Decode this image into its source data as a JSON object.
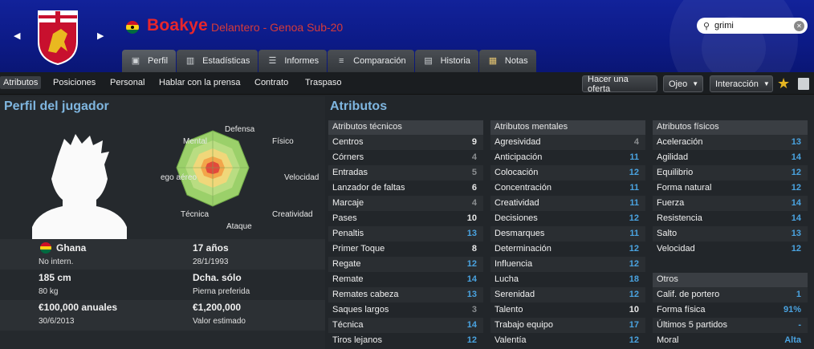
{
  "header": {
    "player_name": "Boakye",
    "player_role": "Delantero - Genoa Sub-20",
    "search_value": "grimi",
    "tabs": [
      {
        "label": "Perfil",
        "icon": "profile-icon",
        "active": true
      },
      {
        "label": "Estadísticas",
        "icon": "stats-icon",
        "active": false
      },
      {
        "label": "Informes",
        "icon": "reports-icon",
        "active": false
      },
      {
        "label": "Comparación",
        "icon": "compare-icon",
        "active": false
      },
      {
        "label": "Historia",
        "icon": "history-icon",
        "active": false
      },
      {
        "label": "Notas",
        "icon": "notes-icon",
        "active": false
      }
    ]
  },
  "subnav": {
    "items": [
      "Atributos",
      "Posiciones",
      "Personal",
      "Hablar con la prensa",
      "Contrato",
      "Traspaso"
    ],
    "make_offer": "Hacer una oferta",
    "eye": "Ojeo",
    "interaction": "Interacción"
  },
  "profile": {
    "title": "Perfil del jugador",
    "radar_labels": {
      "top": "Defensa",
      "top_right": "Físico",
      "right": "Velocidad",
      "bottom_right": "Creatividad",
      "bottom": "Ataque",
      "bottom_left": "Técnica",
      "left": "ego aéreo",
      "top_left": "Mental"
    },
    "nationality": "Ghana",
    "intl": "No intern.",
    "age": "17 años",
    "dob": "28/1/1993",
    "height": "185 cm",
    "weight": "80 kg",
    "foot": "Dcha. sólo",
    "foot_label": "Pierna preferida",
    "wage": "€100,000 anuales",
    "contract_end": "30/6/2013",
    "value": "€1,200,000",
    "value_label": "Valor estimado"
  },
  "attributes": {
    "title": "Atributos",
    "technical": {
      "head": "Atributos técnicos",
      "rows": [
        {
          "name": "Centros",
          "value": "9",
          "tone": "mid"
        },
        {
          "name": "Córners",
          "value": "4",
          "tone": "lo"
        },
        {
          "name": "Entradas",
          "value": "5",
          "tone": "lo"
        },
        {
          "name": "Lanzador de faltas",
          "value": "6",
          "tone": "mid"
        },
        {
          "name": "Marcaje",
          "value": "4",
          "tone": "lo"
        },
        {
          "name": "Pases",
          "value": "10",
          "tone": "mid"
        },
        {
          "name": "Penaltis",
          "value": "13",
          "tone": "hi"
        },
        {
          "name": "Primer Toque",
          "value": "8",
          "tone": "mid"
        },
        {
          "name": "Regate",
          "value": "12",
          "tone": "hi"
        },
        {
          "name": "Remate",
          "value": "14",
          "tone": "hi"
        },
        {
          "name": "Remates cabeza",
          "value": "13",
          "tone": "hi"
        },
        {
          "name": "Saques largos",
          "value": "3",
          "tone": "lo"
        },
        {
          "name": "Técnica",
          "value": "14",
          "tone": "hi"
        },
        {
          "name": "Tiros lejanos",
          "value": "12",
          "tone": "hi"
        }
      ]
    },
    "mental": {
      "head": "Atributos mentales",
      "rows": [
        {
          "name": "Agresividad",
          "value": "4",
          "tone": "lo"
        },
        {
          "name": "Anticipación",
          "value": "11",
          "tone": "hi"
        },
        {
          "name": "Colocación",
          "value": "12",
          "tone": "hi"
        },
        {
          "name": "Concentración",
          "value": "11",
          "tone": "hi"
        },
        {
          "name": "Creatividad",
          "value": "11",
          "tone": "hi"
        },
        {
          "name": "Decisiones",
          "value": "12",
          "tone": "hi"
        },
        {
          "name": "Desmarques",
          "value": "11",
          "tone": "hi"
        },
        {
          "name": "Determinación",
          "value": "12",
          "tone": "hi"
        },
        {
          "name": "Influencia",
          "value": "12",
          "tone": "hi"
        },
        {
          "name": "Lucha",
          "value": "18",
          "tone": "hi"
        },
        {
          "name": "Serenidad",
          "value": "12",
          "tone": "hi"
        },
        {
          "name": "Talento",
          "value": "10",
          "tone": "mid"
        },
        {
          "name": "Trabajo equipo",
          "value": "17",
          "tone": "hi"
        },
        {
          "name": "Valentía",
          "value": "12",
          "tone": "hi"
        }
      ]
    },
    "physical": {
      "head": "Atributos físicos",
      "rows": [
        {
          "name": "Aceleración",
          "value": "13",
          "tone": "hi"
        },
        {
          "name": "Agilidad",
          "value": "14",
          "tone": "hi"
        },
        {
          "name": "Equilibrio",
          "value": "12",
          "tone": "hi"
        },
        {
          "name": "Forma natural",
          "value": "12",
          "tone": "hi"
        },
        {
          "name": "Fuerza",
          "value": "14",
          "tone": "hi"
        },
        {
          "name": "Resistencia",
          "value": "14",
          "tone": "hi"
        },
        {
          "name": "Salto",
          "value": "13",
          "tone": "hi"
        },
        {
          "name": "Velocidad",
          "value": "12",
          "tone": "hi"
        }
      ]
    },
    "other": {
      "head": "Otros",
      "rows": [
        {
          "name": "Calif. de portero",
          "value": "1",
          "tone": "hi"
        },
        {
          "name": "Forma física",
          "value": "91%",
          "tone": "hi"
        },
        {
          "name": "Últimos 5 partidos",
          "value": "-",
          "tone": "hi"
        },
        {
          "name": "Moral",
          "value": "Alta",
          "tone": "hi"
        }
      ]
    }
  },
  "colors": {
    "header": "#0c1a86",
    "name": "#e8262c",
    "accent": "#4aa3e0"
  }
}
